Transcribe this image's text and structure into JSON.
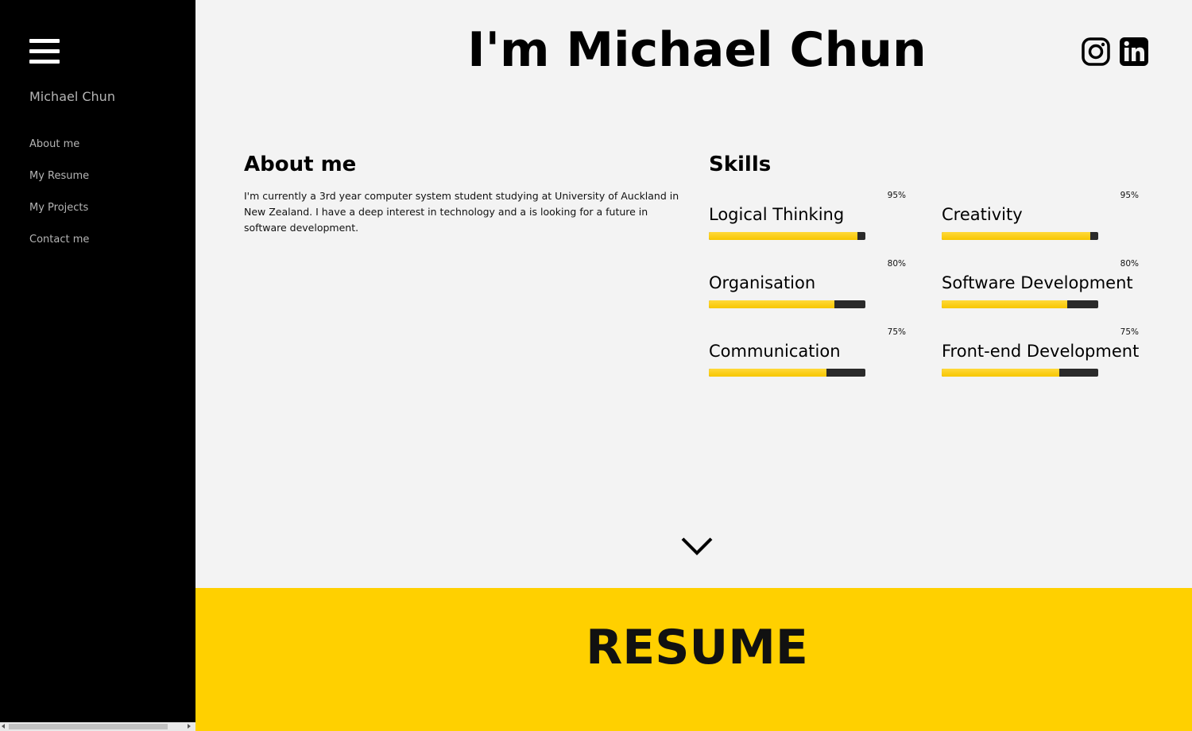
{
  "sidebar": {
    "menu_icon": "hamburger-menu-icon",
    "name": "Michael Chun",
    "nav": [
      {
        "label": "About me"
      },
      {
        "label": "My Resume"
      },
      {
        "label": "My Projects"
      },
      {
        "label": "Contact me"
      }
    ]
  },
  "header": {
    "title": "I'm Michael Chun",
    "social": [
      {
        "icon": "instagram-icon"
      },
      {
        "icon": "linkedin-icon"
      }
    ]
  },
  "about": {
    "heading": "About me",
    "text": "I'm currently a 3rd year computer system student studying at University of Auckland in New Zealand. I have a deep interest in technology and a is looking for a future in software development."
  },
  "skills": {
    "heading": "Skills",
    "items": [
      {
        "label": "Logical Thinking",
        "percent_text": "95%",
        "level": 0.95
      },
      {
        "label": "Creativity",
        "percent_text": "95%",
        "level": 0.95
      },
      {
        "label": "Organisation",
        "percent_text": "80%",
        "level": 0.8
      },
      {
        "label": "Software Development",
        "percent_text": "80%",
        "level": 0.8
      },
      {
        "label": "Communication",
        "percent_text": "75%",
        "level": 0.75
      },
      {
        "label": "Front-end Development",
        "percent_text": "75%",
        "level": 0.75
      }
    ]
  },
  "scroll_down_icon": "chevron-down-icon",
  "resume": {
    "heading": "RESUME"
  },
  "colors": {
    "sidebar_bg": "#000000",
    "page_bg": "#f3f3f3",
    "accent": "#ffd000",
    "bar_track": "#2a2a2a"
  }
}
